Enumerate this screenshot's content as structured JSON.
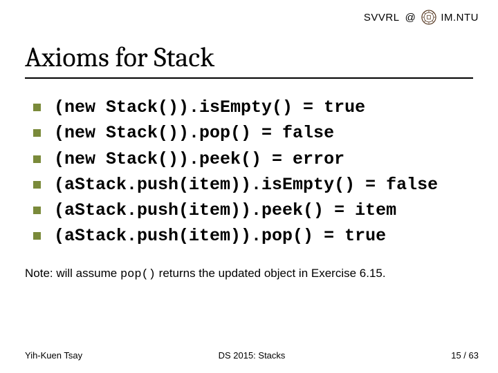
{
  "header": {
    "brand_left": "SVVRL",
    "brand_at": "@",
    "brand_right": "IM.NTU",
    "seal_icon": "ntu-seal-icon"
  },
  "title": "Axioms for Stack",
  "axioms": [
    "(new Stack()).isEmpty() = true",
    "(new Stack()).pop() = false",
    "(new Stack()).peek() = error",
    "(aStack.push(item)).isEmpty() = false",
    "(aStack.push(item)).peek() = item",
    "(aStack.push(item)).pop() = true"
  ],
  "note": {
    "prefix": "Note: will assume ",
    "code": "pop()",
    "suffix": " returns the updated object in Exercise 6.15."
  },
  "footer": {
    "left": "Yih-Kuen Tsay",
    "center": "DS 2015: Stacks",
    "right": "15 / 63"
  }
}
